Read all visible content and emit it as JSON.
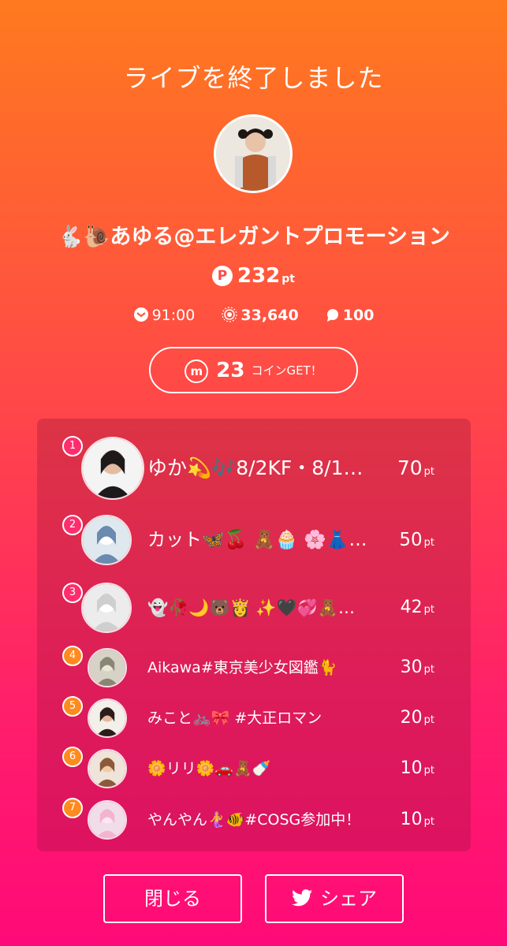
{
  "header": {
    "title": "ライブを終了しました"
  },
  "broadcaster": {
    "name": "🐇🐌あゆる@エレガントプロモーション",
    "points": "232",
    "points_unit": "pt"
  },
  "stats": {
    "duration": "91:00",
    "viewers": "33,640",
    "comments": "100"
  },
  "coin": {
    "icon_label": "m",
    "amount": "23",
    "label": "コインGET！"
  },
  "ranking": [
    {
      "rank": "1",
      "name": "ゆか💫🎶8/2KF・8/1…",
      "points": "70",
      "unit": "pt",
      "avatar_icon": "girl-avatar"
    },
    {
      "rank": "2",
      "name": "カット🦋🍒 🧸🧁 🌸👗…",
      "points": "50",
      "unit": "pt",
      "avatar_icon": "sticker-avatar"
    },
    {
      "rank": "3",
      "name": "👻🥀🌙🐻👸 ✨🖤💞🧸…",
      "points": "42",
      "unit": "pt",
      "avatar_icon": "bear-avatar"
    },
    {
      "rank": "4",
      "name": "Aikawa#東京美少女図鑑🐈",
      "points": "30",
      "unit": "pt",
      "avatar_icon": "drawing-avatar"
    },
    {
      "rank": "5",
      "name": "みこと🚲🎀 #大正ロマン",
      "points": "20",
      "unit": "pt",
      "avatar_icon": "glasses-avatar"
    },
    {
      "rank": "6",
      "name": "🌼リリ🌼🚗🧸🍼",
      "points": "10",
      "unit": "pt",
      "avatar_icon": "woman-avatar"
    },
    {
      "rank": "7",
      "name": "やんやん🧜‍♀️🐠#COSG参加中！",
      "points": "10",
      "unit": "pt",
      "avatar_icon": "pink-avatar"
    }
  ],
  "buttons": {
    "close": "閉じる",
    "share": "シェア"
  },
  "colors": {
    "badge_top": "#ff2d6e",
    "badge_orange": "#ff8a1e",
    "gradient_top": "#ff7a1e",
    "gradient_bottom": "#ff0a78"
  }
}
